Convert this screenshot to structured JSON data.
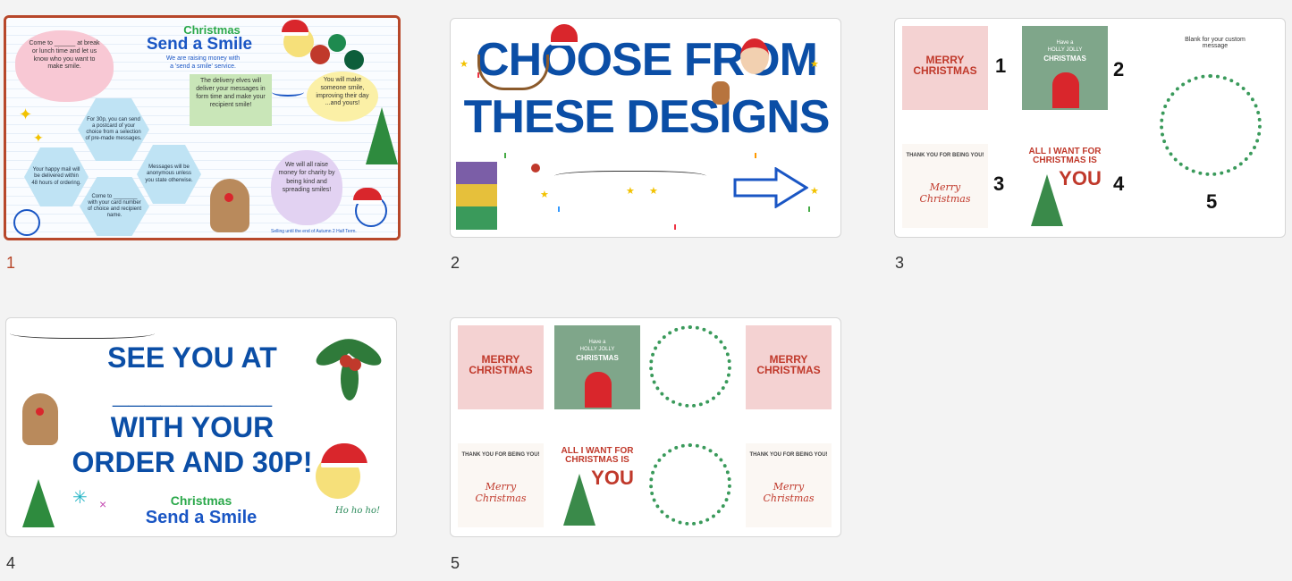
{
  "slides": [
    {
      "number": "1",
      "selected": true,
      "christmas": "Christmas",
      "title": "Send a Smile",
      "subtitle1": "We are raising money with",
      "subtitle2": "a 'send a smile' service.",
      "cloud_text": "Come to ______ at break or lunch time and let us know who you want to make smile.",
      "elves_text": "The delivery elves will deliver your messages in form time and make your recipient smile!",
      "smile_text": "You will make someone smile, improving their day ...and yours!",
      "hex_30p": "For 30p, you can send a postcard of your choice from a selection of pre-made messages.",
      "hex_happy": "Your happy mail will be delivered within 48 hours of ordering.",
      "hex_come": "Come to ________ with your card number of choice and recipient name.",
      "hex_anon": "Messages will be anonymous unless you state otherwise.",
      "charity_text": "We will all raise money for charity by being kind and spreading smiles!",
      "footer": "Selling until the end of Autumn 2 Half Term."
    },
    {
      "number": "2",
      "line1": "CHOOSE FROM",
      "line2": "THESE DESIGNS"
    },
    {
      "number": "3",
      "card1": "MERRY CHRISTMAS",
      "card2_a": "Have a",
      "card2_b": "HOLLY JOLLY",
      "card2_c": "CHRISTMAS",
      "card3_a": "THANK YOU FOR BEING YOU!",
      "card3_b": "Merry Christmas",
      "card4": "ALL I WANT FOR CHRISTMAS IS",
      "card4_you": "YOU",
      "labels": [
        "1",
        "2",
        "3",
        "4",
        "5"
      ],
      "blank_note": "Blank for your custom message"
    },
    {
      "number": "4",
      "line1": "SEE YOU AT",
      "line2": "__________",
      "line3": "WITH YOUR",
      "line4": "ORDER AND 30P!",
      "christmas": "Christmas",
      "send": "Send a Smile",
      "hohoho": "Ho ho ho!"
    },
    {
      "number": "5"
    }
  ],
  "colors": {
    "accent": "#b7472a",
    "title_blue": "#0b4ea6",
    "card_red": "#c0392b",
    "card_green": "#7fa68a",
    "card_pink": "#f4d2d2"
  }
}
